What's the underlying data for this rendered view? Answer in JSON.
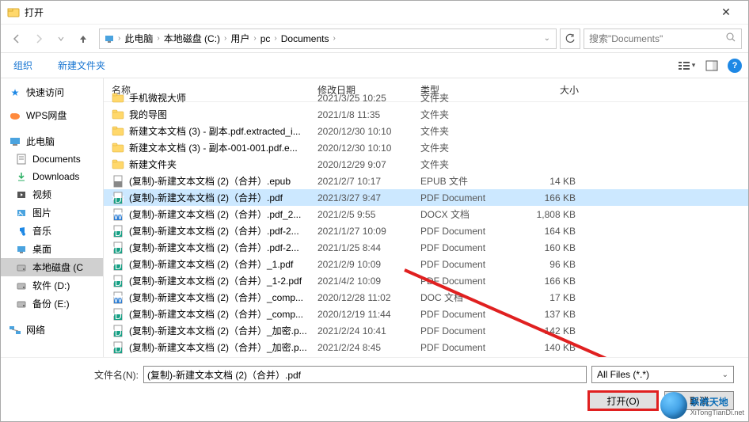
{
  "window": {
    "title": "打开"
  },
  "nav": {
    "back_icon": "arrow-left",
    "forward_icon": "arrow-right",
    "up_icon": "arrow-up",
    "breadcrumb": [
      "此电脑",
      "本地磁盘 (C:)",
      "用户",
      "pc",
      "Documents"
    ],
    "refresh_icon": "refresh",
    "search_placeholder": "搜索\"Documents\"",
    "search_icon": "search"
  },
  "toolbar": {
    "organize": "组织",
    "new_folder": "新建文件夹",
    "view_icon": "view-list",
    "help_icon": "?"
  },
  "sidebar": {
    "quick_access": "快速访问",
    "wps": "WPS网盘",
    "this_pc": "此电脑",
    "items": [
      {
        "label": "Documents",
        "icon": "doc"
      },
      {
        "label": "Downloads",
        "icon": "download"
      },
      {
        "label": "视频",
        "icon": "video"
      },
      {
        "label": "图片",
        "icon": "image"
      },
      {
        "label": "音乐",
        "icon": "music"
      },
      {
        "label": "桌面",
        "icon": "desktop"
      },
      {
        "label": "本地磁盘 (C",
        "icon": "disk",
        "active": true
      },
      {
        "label": "软件 (D:)",
        "icon": "disk"
      },
      {
        "label": "备份 (E:)",
        "icon": "disk"
      }
    ],
    "network": "网络"
  },
  "columns": {
    "name": "名称",
    "date": "修改日期",
    "type": "类型",
    "size": "大小"
  },
  "files": [
    {
      "icon": "folder",
      "name": "手机微视大师",
      "date": "2021/3/25 10:25",
      "type": "文件夹",
      "size": ""
    },
    {
      "icon": "folder",
      "name": "我的导图",
      "date": "2021/1/8 11:35",
      "type": "文件夹",
      "size": ""
    },
    {
      "icon": "folder",
      "name": "新建文本文档 (3) - 副本.pdf.extracted_i...",
      "date": "2020/12/30 10:10",
      "type": "文件夹",
      "size": ""
    },
    {
      "icon": "folder",
      "name": "新建文本文档 (3) - 副本-001-001.pdf.e...",
      "date": "2020/12/30 10:10",
      "type": "文件夹",
      "size": ""
    },
    {
      "icon": "folder",
      "name": "新建文件夹",
      "date": "2020/12/29 9:07",
      "type": "文件夹",
      "size": ""
    },
    {
      "icon": "epub",
      "name": "(复制)-新建文本文档 (2)（合并）.epub",
      "date": "2021/2/7 10:17",
      "type": "EPUB 文件",
      "size": "14 KB"
    },
    {
      "icon": "pdf",
      "name": "(复制)-新建文本文档 (2)（合并）.pdf",
      "date": "2021/3/27 9:47",
      "type": "PDF Document",
      "size": "166 KB",
      "selected": true
    },
    {
      "icon": "docx",
      "name": "(复制)-新建文本文档 (2)（合并）.pdf_2...",
      "date": "2021/2/5 9:55",
      "type": "DOCX 文档",
      "size": "1,808 KB"
    },
    {
      "icon": "pdf",
      "name": "(复制)-新建文本文档 (2)（合并）.pdf-2...",
      "date": "2021/1/27 10:09",
      "type": "PDF Document",
      "size": "164 KB"
    },
    {
      "icon": "pdf",
      "name": "(复制)-新建文本文档 (2)（合并）.pdf-2...",
      "date": "2021/1/25 8:44",
      "type": "PDF Document",
      "size": "160 KB"
    },
    {
      "icon": "pdf",
      "name": "(复制)-新建文本文档 (2)（合并）_1.pdf",
      "date": "2021/2/9 10:09",
      "type": "PDF Document",
      "size": "96 KB"
    },
    {
      "icon": "pdf",
      "name": "(复制)-新建文本文档 (2)（合并）_1-2.pdf",
      "date": "2021/4/2 10:09",
      "type": "PDF Document",
      "size": "166 KB"
    },
    {
      "icon": "doc",
      "name": "(复制)-新建文本文档 (2)（合并）_comp...",
      "date": "2020/12/28 11:02",
      "type": "DOC 文档",
      "size": "17 KB"
    },
    {
      "icon": "pdf",
      "name": "(复制)-新建文本文档 (2)（合并）_comp...",
      "date": "2020/12/19 11:44",
      "type": "PDF Document",
      "size": "137 KB"
    },
    {
      "icon": "pdf",
      "name": "(复制)-新建文本文档 (2)（合并）_加密.p...",
      "date": "2021/2/24 10:41",
      "type": "PDF Document",
      "size": "142 KB"
    },
    {
      "icon": "pdf",
      "name": "(复制)-新建文本文档 (2)（合并）_加密.p...",
      "date": "2021/2/24 8:45",
      "type": "PDF Document",
      "size": "140 KB"
    }
  ],
  "bottom": {
    "filename_label": "文件名(N):",
    "filename_value": "(复制)-新建文本文档 (2)（合并）.pdf",
    "filter": "All Files (*.*)",
    "open": "打开(O)",
    "cancel": "取消"
  },
  "watermark": {
    "main": "系统天地",
    "sub": "XiTongTianDi.net"
  }
}
